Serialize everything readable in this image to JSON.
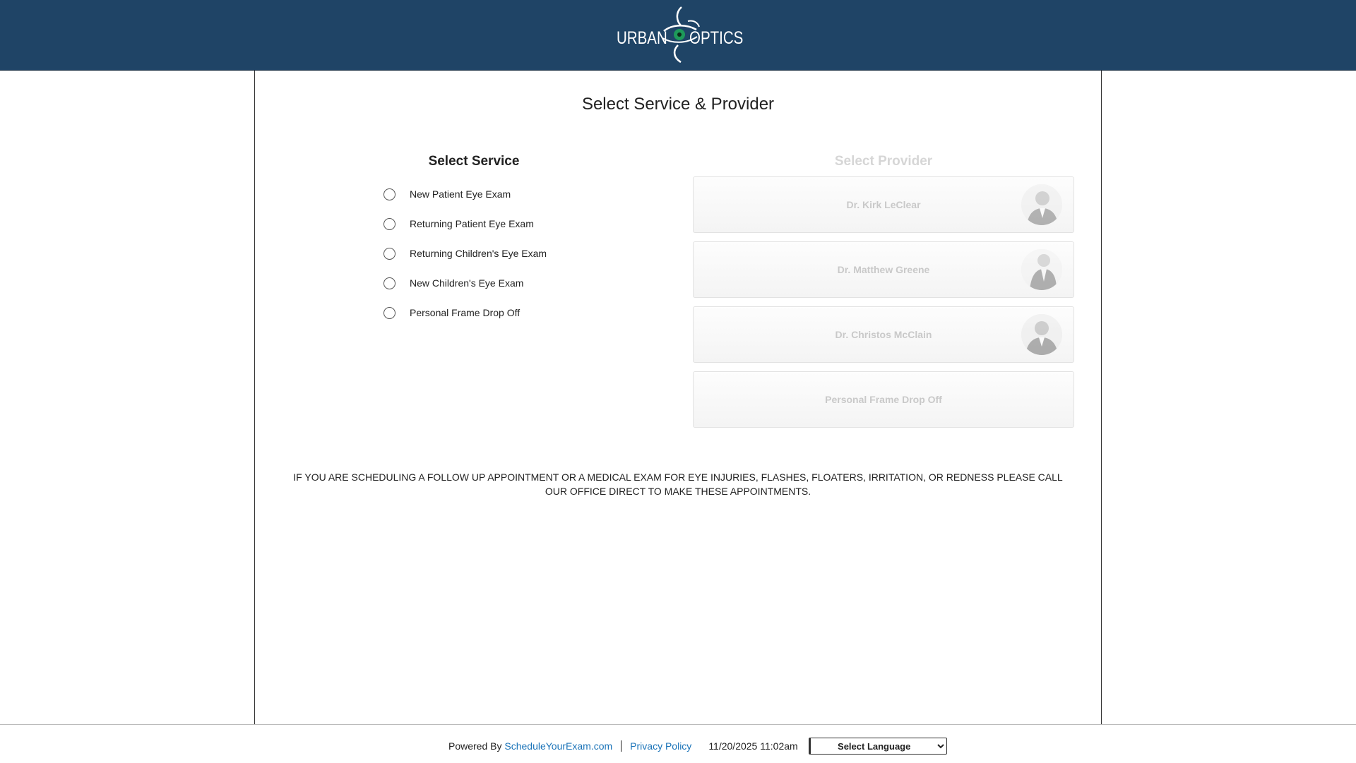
{
  "header": {
    "logo_left": "URBAN",
    "logo_right": "OPTICS",
    "bg_color": "#1f4466"
  },
  "page": {
    "title": "Select Service & Provider"
  },
  "services": {
    "heading": "Select Service",
    "items": [
      {
        "label": "New Patient Eye Exam",
        "selected": false
      },
      {
        "label": "Returning Patient Eye Exam",
        "selected": false
      },
      {
        "label": "Returning Children's Eye Exam",
        "selected": false
      },
      {
        "label": "New Children's Eye Exam",
        "selected": false
      },
      {
        "label": "Personal Frame Drop Off",
        "selected": false
      }
    ]
  },
  "providers": {
    "heading": "Select Provider",
    "disabled": true,
    "items": [
      {
        "name": "Dr. Kirk LeClear",
        "has_photo": true
      },
      {
        "name": "Dr. Matthew Greene",
        "has_photo": true
      },
      {
        "name": "Dr. Christos McClain",
        "has_photo": true
      },
      {
        "name": "Personal Frame Drop Off",
        "has_photo": false
      }
    ]
  },
  "notice": {
    "text": "IF YOU ARE SCHEDULING A FOLLOW UP APPOINTMENT OR A MEDICAL EXAM FOR EYE INJURIES, FLASHES, FLOATERS, IRRITATION, OR REDNESS PLEASE CALL OUR OFFICE DIRECT TO MAKE THESE APPOINTMENTS."
  },
  "footer": {
    "powered_by": "Powered By",
    "powered_link": "ScheduleYourExam.com",
    "privacy": "Privacy Policy",
    "datetime": "11/20/2025 11:02am",
    "language_select": "Select Language",
    "link_color": "#1a73b8"
  }
}
